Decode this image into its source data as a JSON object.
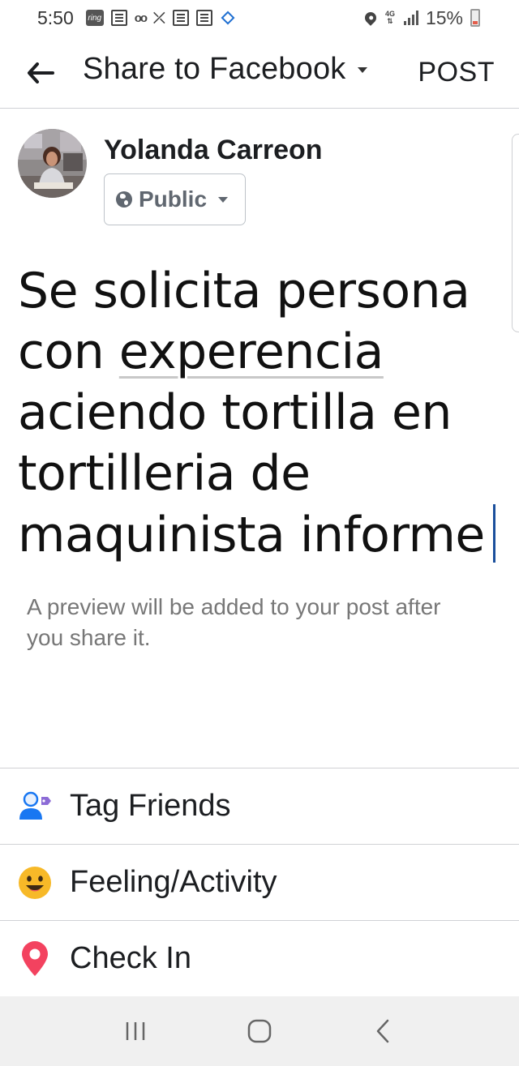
{
  "status_bar": {
    "time": "5:50",
    "battery_percent": "15%",
    "notification_icons": [
      "ring-icon",
      "news-icon",
      "voicemail-icon",
      "missed-call-icon",
      "news-icon",
      "tmobile-icon",
      "diamond-icon"
    ],
    "system_icons": [
      "location-icon",
      "lte-icon",
      "signal-icon",
      "battery-icon"
    ],
    "ring_text": "ring"
  },
  "header": {
    "title": "Share to Facebook",
    "post_label": "POST"
  },
  "composer": {
    "user_name": "Yolanda Carreon",
    "privacy_label": "Public",
    "text_line1": "Se solicita persona",
    "text_line2_prefix": "con ",
    "text_line2_underlined": "experencia",
    "text_line3": "aciendo tortilla en",
    "text_line4": "tortilleria de",
    "text_line5": "maquinista informe",
    "preview_note": "A preview will be added to your post after you share it."
  },
  "actions": [
    {
      "label": "Tag Friends",
      "icon": "tag-friends-icon"
    },
    {
      "label": "Feeling/Activity",
      "icon": "smiley-icon"
    },
    {
      "label": "Check In",
      "icon": "location-pin-icon"
    }
  ],
  "colors": {
    "accent_blue": "#1877f2",
    "cursor_blue": "#1a4f9c",
    "smiley_yellow": "#f7b928",
    "pin_red": "#f3425f",
    "secondary_text": "#606770"
  }
}
